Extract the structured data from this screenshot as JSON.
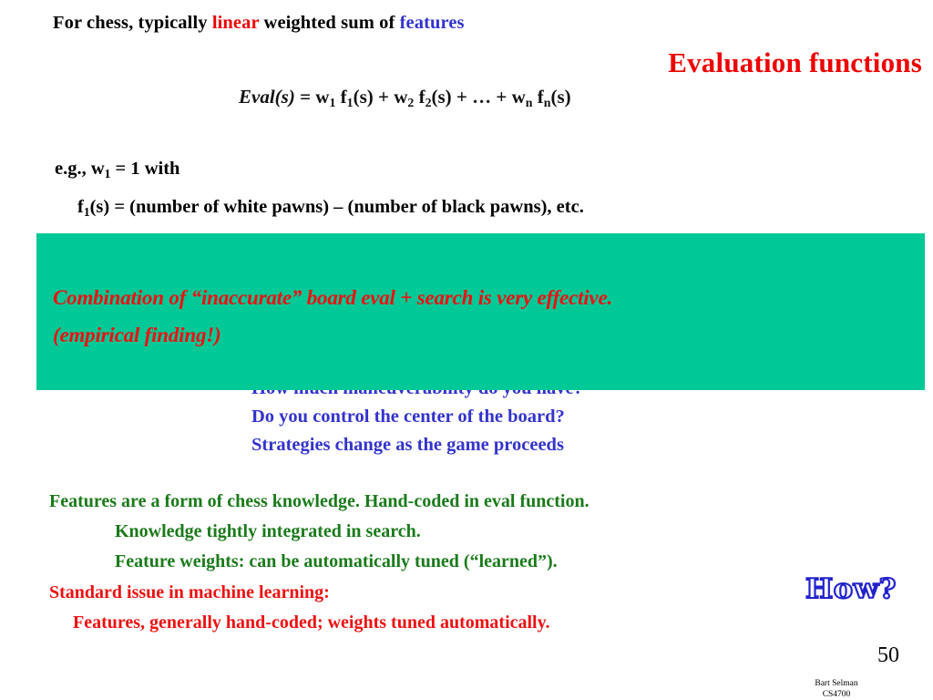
{
  "slide": {
    "title": "Evaluation functions",
    "page_number": "50",
    "author": "Bart Selman",
    "course": "CS4700"
  },
  "top_line": {
    "part1": "For chess, typically ",
    "emph_linear": "linear",
    "part2": " weighted sum of ",
    "emph_features": "features"
  },
  "formula": {
    "lhs": "Eval(s)",
    "eq": " = ",
    "w1": "w",
    "w1sub": "1",
    "f1": " f",
    "f1sub": "1",
    "f1arg": "(s) + ",
    "w2": "w",
    "w2sub": "2",
    "f2": " f",
    "f2sub": "2",
    "f2arg": "(s) + ",
    "ellipsis": "… + ",
    "wn": "w",
    "wnsub": "n",
    "fn": " f",
    "fnsub": "n",
    "fnarg": "(s)",
    "full_text": "Eval(s) = w1 f1(s) + w2 f2(s) + … + wn fn(s)"
  },
  "example": {
    "line1_a": "e.g., w",
    "line1_sub": "1",
    "line1_b": " = 1 with",
    "line2_a": "f",
    "line2_sub": "1",
    "line2_b": "(s) = (number of white pawns) –  (number of black pawns), etc."
  },
  "green_box": {
    "line1": "Combination of “inaccurate” board eval  + search is very effective.",
    "line2": "(empirical finding!)",
    "bg_color": "#00c896",
    "text_color": "#ee1111"
  },
  "blue_questions": {
    "color": "#3333cc",
    "lines": [
      "How much maneuverability do you have?",
      "Do you control the center of the board?",
      "Strategies change as the game proceeds"
    ]
  },
  "knowledge_block": {
    "color": "#1a7a1a",
    "lines": [
      "Features are a form of chess knowledge. Hand-coded in eval function.",
      "Knowledge tightly integrated in search.",
      "Feature weights: can be automatically tuned (“learned”)."
    ]
  },
  "standard_issue": {
    "color": "#ee1111",
    "lines": [
      "Standard issue in machine learning:",
      "Features, generally hand-coded; weights tuned automatically."
    ]
  },
  "wordart": {
    "text": "How?",
    "stroke_color": "#2222cc"
  }
}
